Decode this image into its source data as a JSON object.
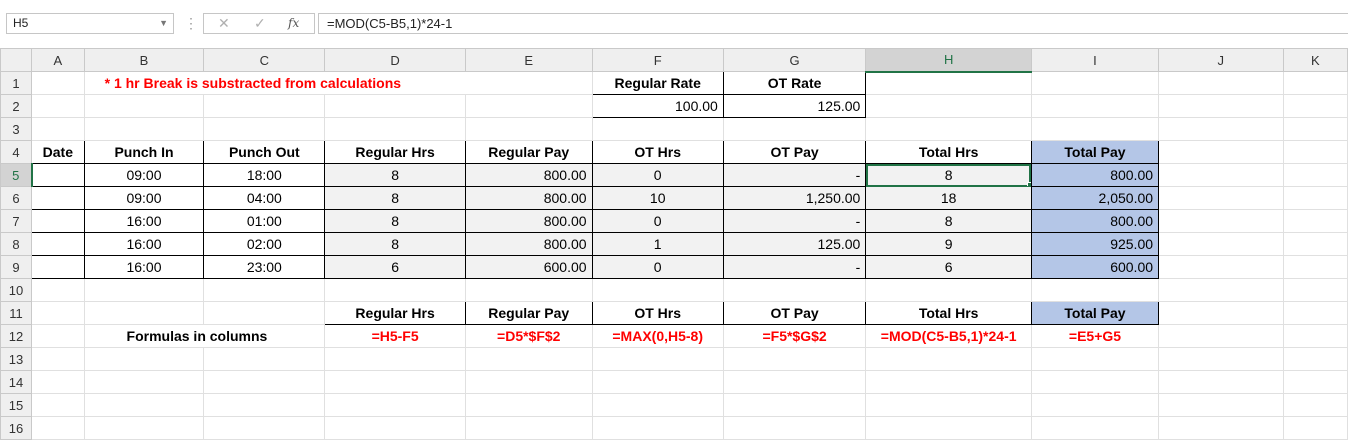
{
  "formula_bar": {
    "name_box": "H5",
    "cancel_glyph": "✕",
    "enter_glyph": "✓",
    "fx_glyph": "fx",
    "formula": "=MOD(C5-B5,1)*24-1"
  },
  "columns": [
    "A",
    "B",
    "C",
    "D",
    "E",
    "F",
    "G",
    "H",
    "I",
    "J",
    "K"
  ],
  "rows": [
    "1",
    "2",
    "3",
    "4",
    "5",
    "6",
    "7",
    "8",
    "9",
    "10",
    "11",
    "12",
    "13",
    "14",
    "15",
    "16"
  ],
  "note": "* 1 hr Break is substracted from calculations",
  "rates": {
    "regular_label": "Regular Rate",
    "ot_label": "OT Rate",
    "regular_value": "100.00",
    "ot_value": "125.00"
  },
  "table_headers": [
    "Date",
    "Punch In",
    "Punch Out",
    "Regular Hrs",
    "Regular Pay",
    "OT Hrs",
    "OT Pay",
    "Total Hrs",
    "Total Pay"
  ],
  "table_rows": [
    {
      "date": "",
      "punch_in": "09:00",
      "punch_out": "18:00",
      "reg_hrs": "8",
      "reg_pay": "800.00",
      "ot_hrs": "0",
      "ot_pay": "-",
      "total_hrs": "8",
      "total_pay": "800.00"
    },
    {
      "date": "",
      "punch_in": "09:00",
      "punch_out": "04:00",
      "reg_hrs": "8",
      "reg_pay": "800.00",
      "ot_hrs": "10",
      "ot_pay": "1,250.00",
      "total_hrs": "18",
      "total_pay": "2,050.00"
    },
    {
      "date": "",
      "punch_in": "16:00",
      "punch_out": "01:00",
      "reg_hrs": "8",
      "reg_pay": "800.00",
      "ot_hrs": "0",
      "ot_pay": "-",
      "total_hrs": "8",
      "total_pay": "800.00"
    },
    {
      "date": "",
      "punch_in": "16:00",
      "punch_out": "02:00",
      "reg_hrs": "8",
      "reg_pay": "800.00",
      "ot_hrs": "1",
      "ot_pay": "125.00",
      "total_hrs": "9",
      "total_pay": "925.00"
    },
    {
      "date": "",
      "punch_in": "16:00",
      "punch_out": "23:00",
      "reg_hrs": "6",
      "reg_pay": "600.00",
      "ot_hrs": "0",
      "ot_pay": "-",
      "total_hrs": "6",
      "total_pay": "600.00"
    }
  ],
  "formula_headers": [
    "Regular Hrs",
    "Regular Pay",
    "OT Hrs",
    "OT Pay",
    "Total Hrs",
    "Total Pay"
  ],
  "formulas_label": "Formulas in columns",
  "formulas": [
    "=H5-F5",
    "=D5*$F$2",
    "=MAX(0,H5-8)",
    "=F5*$G$2",
    "=MOD(C5-B5,1)*24-1",
    "=E5+G5"
  ],
  "colors": {
    "accent": "#217346",
    "highlight": "#b4c6e7",
    "red": "#ff0000"
  }
}
